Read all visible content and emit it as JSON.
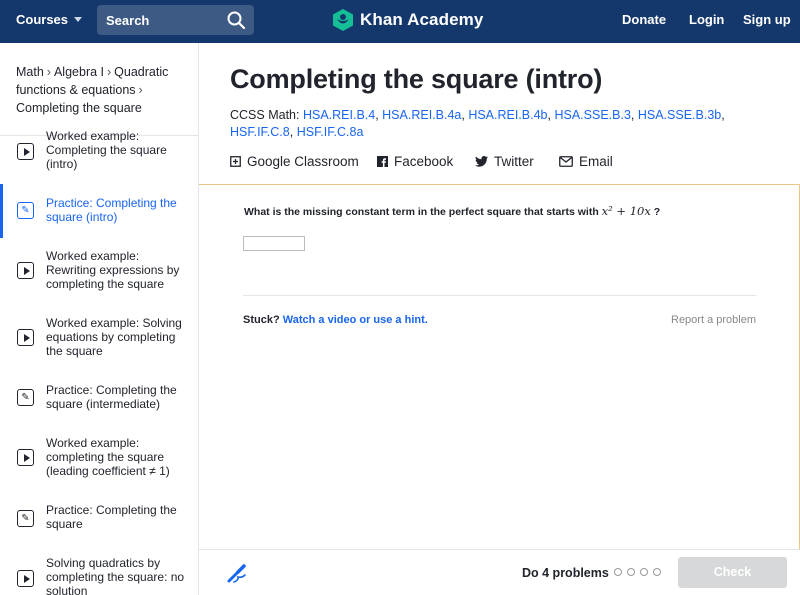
{
  "header": {
    "courses_label": "Courses",
    "search_label": "Search",
    "logo_text": "Khan Academy",
    "donate_label": "Donate",
    "login_label": "Login",
    "signup_label": "Sign up",
    "bg_color": "#14386b"
  },
  "breadcrumb": {
    "items": [
      "Math",
      "Algebra I",
      "Quadratic functions & equations",
      "Completing the square"
    ]
  },
  "sidebar": {
    "items": [
      {
        "label": "Worked example: Completing the square (intro)",
        "icon": "play-icon",
        "active": false
      },
      {
        "label": "Practice: Completing the square (intro)",
        "icon": "pencil-icon",
        "active": true
      },
      {
        "label": "Worked example: Rewriting expressions by completing the square",
        "icon": "play-icon",
        "active": false
      },
      {
        "label": "Worked example: Solving equations by completing the square",
        "icon": "play-icon",
        "active": false
      },
      {
        "label": "Practice: Completing the square (intermediate)",
        "icon": "pencil-icon",
        "active": false
      },
      {
        "label": "Worked example: completing the square (leading coefficient ≠ 1)",
        "icon": "play-icon",
        "active": false
      },
      {
        "label": "Practice: Completing the square",
        "icon": "pencil-icon",
        "active": false
      },
      {
        "label": "Solving quadratics by completing the square: no solution",
        "icon": "play-icon",
        "active": false
      }
    ]
  },
  "main": {
    "title": "Completing the square (intro)",
    "ccss_prefix": "CCSS Math:",
    "ccss_links": [
      "HSA.REI.B.4",
      "HSA.REI.B.4a",
      "HSA.REI.B.4b",
      "HSA.SSE.B.3",
      "HSA.SSE.B.3b",
      "HSF.IF.C.8",
      "HSF.IF.C.8a"
    ],
    "share": {
      "google_classroom": "Google Classroom",
      "facebook": "Facebook",
      "twitter": "Twitter",
      "email": "Email"
    }
  },
  "exercise": {
    "question_text": "What is the missing constant term in the perfect square that starts with",
    "question_math": "x² + 10x",
    "question_end": "?",
    "answer_value": "",
    "stuck_label": "Stuck?",
    "hint_link": "Watch a video or use a hint.",
    "report_label": "Report a problem"
  },
  "footer": {
    "do_problems": "Do 4 problems",
    "check_label": "Check",
    "accent_color": "#1865f2"
  }
}
